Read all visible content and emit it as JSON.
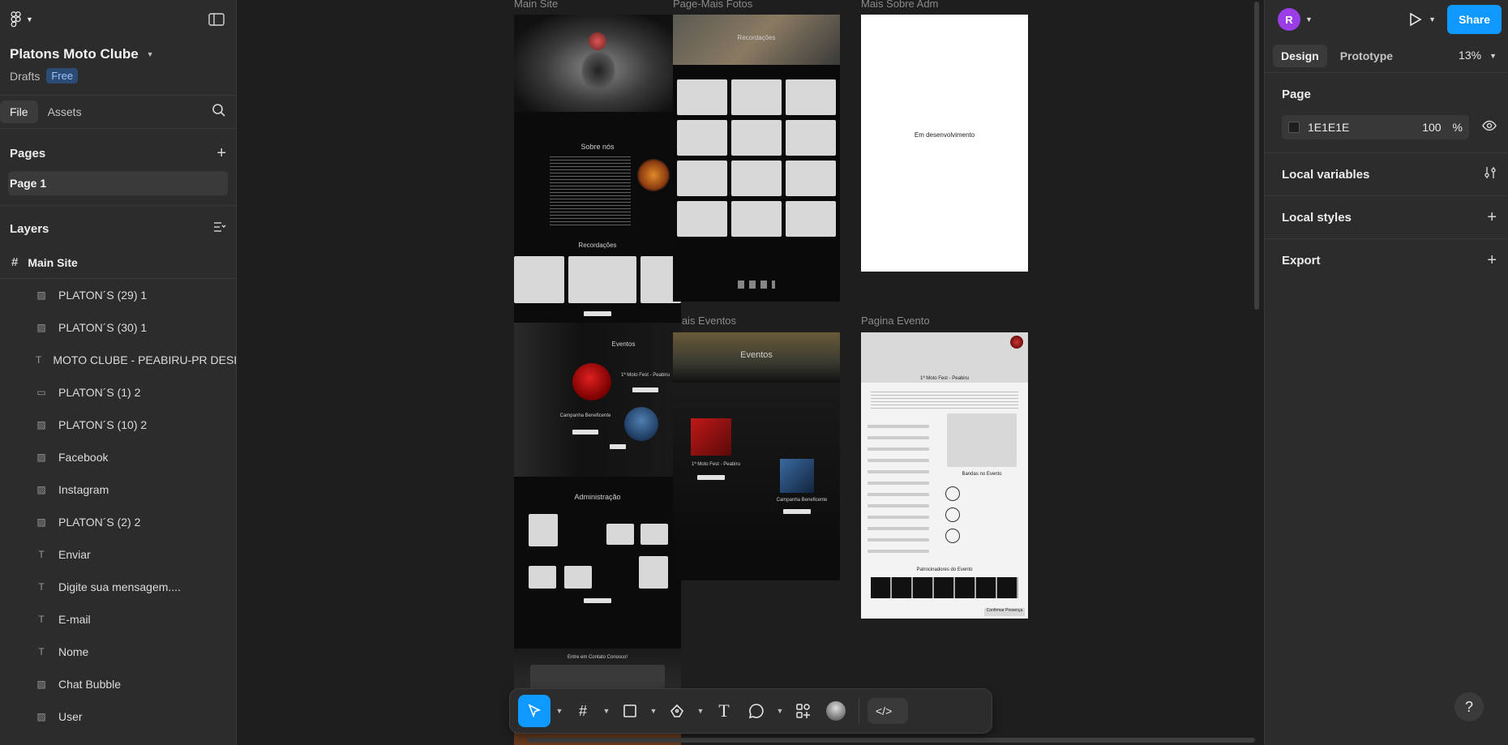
{
  "app": {
    "project_name": "Platons Moto Clube",
    "location": "Drafts",
    "plan_badge": "Free",
    "colors": {
      "accent": "#0d99ff",
      "avatar": "#9b3ee8",
      "canvas": "#1e1e1e",
      "panel": "#2c2c2c"
    }
  },
  "left_tabs": {
    "file": "File",
    "assets": "Assets"
  },
  "pages": {
    "title": "Pages",
    "items": [
      {
        "label": "Page 1"
      }
    ]
  },
  "layers": {
    "title": "Layers",
    "root": "Main Site",
    "items": [
      {
        "label": "PLATON´S (29) 1",
        "icon": "image-icon"
      },
      {
        "label": "PLATON´S (30) 1",
        "icon": "image-icon"
      },
      {
        "label": "MOTO CLUBE - PEABIRU-PR DESDE",
        "icon": "text-icon"
      },
      {
        "label": "PLATON´S (1) 2",
        "icon": "rectangle-icon"
      },
      {
        "label": "PLATON´S (10) 2",
        "icon": "image-icon"
      },
      {
        "label": "Facebook",
        "icon": "image-icon"
      },
      {
        "label": "Instagram",
        "icon": "image-icon"
      },
      {
        "label": "PLATON´S (2) 2",
        "icon": "image-icon"
      },
      {
        "label": "Enviar",
        "icon": "text-icon"
      },
      {
        "label": "Digite sua mensagem....",
        "icon": "text-icon"
      },
      {
        "label": "E-mail",
        "icon": "text-icon"
      },
      {
        "label": "Nome",
        "icon": "text-icon"
      },
      {
        "label": "Chat Bubble",
        "icon": "image-icon"
      },
      {
        "label": "User",
        "icon": "image-icon"
      }
    ]
  },
  "canvas": {
    "frames": {
      "main_site": "Main Site",
      "page_mais_fotos": "Page-Mais Fotos",
      "mais_sobre_adm": "Mais Sobre Adm",
      "mais_eventos": "Mais Eventos",
      "pagina_evento": "Pagina Evento"
    },
    "main_site_texts": {
      "sobre": "Sobre nós",
      "recordacoes": "Recordações",
      "eventos": "Eventos",
      "moto_fest": "1ª Moto Fest - Peabiru",
      "campanha": "Campanha Beneficente",
      "administracao": "Administração",
      "contato": "Entre em Contato Conosco!"
    },
    "fotos_title": "Recordações",
    "em_desenvolvimento": "Em desenvolvimento",
    "mais_eventos_texts": {
      "title": "Eventos",
      "moto_fest": "1ª Moto Fest - Peabiru",
      "campanha": "Campanha Beneficente"
    },
    "pagina_evento_texts": {
      "title": "1ª Moto Fest - Peabiru",
      "bandas": "Bandas no Evento",
      "patrocinadores": "Patrocinadores do Evento",
      "confirmar": "Confirmar Presença"
    }
  },
  "right": {
    "avatar_initial": "R",
    "share": "Share",
    "tabs": {
      "design": "Design",
      "prototype": "Prototype"
    },
    "zoom": "13%",
    "page_section": "Page",
    "page_color": "1E1E1E",
    "page_opacity": "100",
    "percent": "%",
    "local_variables": "Local variables",
    "local_styles": "Local styles",
    "export": "Export"
  },
  "help": "?"
}
